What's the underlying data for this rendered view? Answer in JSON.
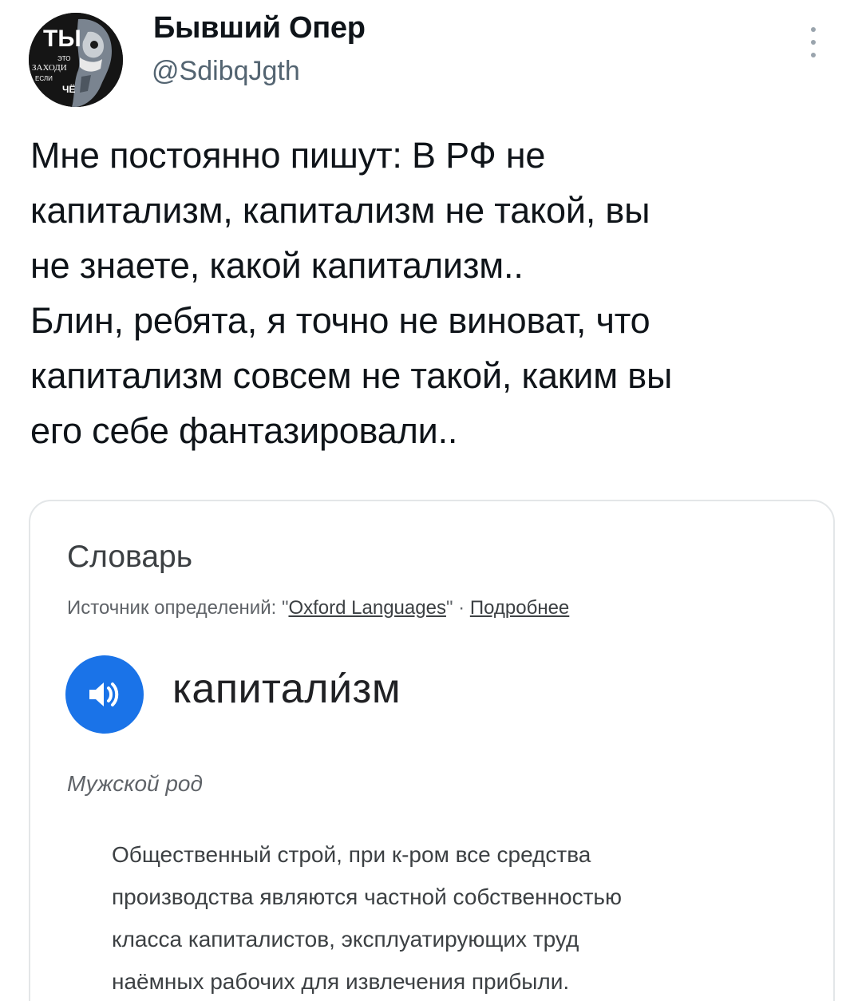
{
  "tweet": {
    "author": {
      "display_name": "Бывший Опер",
      "handle": "@SdibqJgth",
      "avatar_text": {
        "big": "ТЫ",
        "line1": "ЭТО",
        "line2": "ЗАХОДИ",
        "line3": "ЕСЛИ",
        "line4": "ЧЁ"
      }
    },
    "more_icon": "more-vertical-icon",
    "text_lines": [
      "Мне постоянно пишут: В РФ не",
      "капитализм, капитализм не такой, вы",
      "не знаете, какой капитализм..",
      "Блин, ребята, я точно не виноват, что",
      "капитализм совсем не такой, каким вы",
      "его себе фантазировали.."
    ]
  },
  "dictionary": {
    "title": "Словарь",
    "source_prefix": "Источник определений: \"",
    "source_link": "Oxford Languages",
    "source_sep": "\" · ",
    "more_link": "Подробнее",
    "speaker_icon": "speaker-icon",
    "headword": "капитали́зм",
    "gender": "Мужской род",
    "definition_lines": [
      "Общественный строй, при к-ром все средства",
      "производства являются частной собственностью",
      "класса капиталистов, эксплуатирующих труд",
      "наёмных рабочих для извлечения прибыли."
    ]
  },
  "colors": {
    "text": "#0f1419",
    "secondary": "#536471",
    "accent_blue": "#1a73e8",
    "card_border": "#e3e6e8"
  }
}
